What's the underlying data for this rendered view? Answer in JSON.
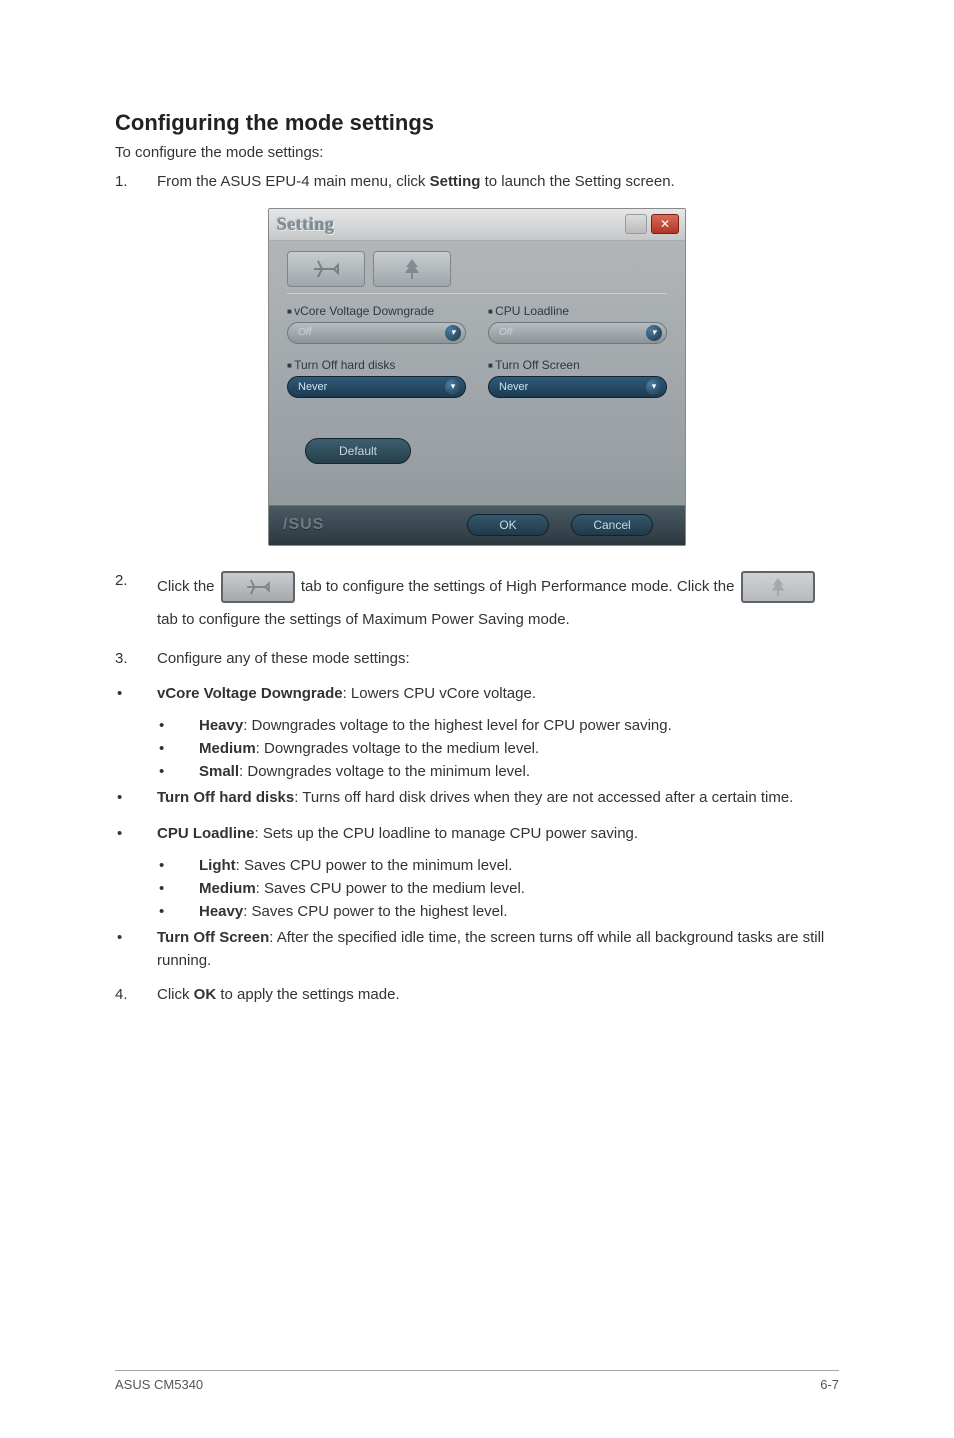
{
  "heading": "Configuring the mode settings",
  "intro": "To configure the mode settings:",
  "step1": {
    "num": "1.",
    "text_a": "From the ASUS EPU-4 main menu, click ",
    "bold": "Setting",
    "text_b": "  to launch the Setting screen."
  },
  "screenshot": {
    "title": "Setting",
    "close_glyph": "✕",
    "vcore_label": "vCore Voltage Downgrade",
    "vcore_value": "Off",
    "cpu_label": "CPU Loadline",
    "cpu_value": "Off",
    "disks_label": "Turn Off hard disks",
    "disks_value": "Never",
    "screen_label": "Turn Off Screen",
    "screen_value": "Never",
    "default_btn": "Default",
    "ok_btn": "OK",
    "cancel_btn": "Cancel",
    "asus_logo": "/SUS"
  },
  "step2": {
    "num": "2.",
    "a": "Click the ",
    "b": " tab to configure the settings of High Performance mode. Click the ",
    "c": " tab to configure the settings of Maximum Power Saving mode."
  },
  "step3": {
    "num": "3.",
    "text": "Configure any of these mode settings:"
  },
  "b_vcore": {
    "label": "vCore Voltage Downgrade",
    "tail": ": Lowers CPU vCore voltage."
  },
  "b_heavy": {
    "label": "Heavy",
    "tail": ": Downgrades voltage to the highest level for CPU power saving."
  },
  "b_medium": {
    "label": "Medium",
    "tail": ": Downgrades voltage to the medium level."
  },
  "b_small": {
    "label": "Small",
    "tail": ": Downgrades voltage to the minimum level."
  },
  "b_disks": {
    "label": "Turn Off hard disks",
    "tail": ": Turns off hard disk drives when they are not accessed after a certain time."
  },
  "b_loadline": {
    "label": "CPU Loadline",
    "tail": ": Sets up the CPU loadline to manage CPU power saving."
  },
  "b_light": {
    "label": "Light",
    "tail": ": Saves CPU power to the minimum level."
  },
  "b_med2": {
    "label": "Medium",
    "tail": ": Saves CPU power to the medium level."
  },
  "b_hvy2": {
    "label": "Heavy",
    "tail": ": Saves CPU power to the highest level."
  },
  "b_screen": {
    "label": "Turn Off Screen",
    "tail": ": After the specified idle time, the screen turns off while all background tasks are still running."
  },
  "step4": {
    "num": "4.",
    "a": "Click ",
    "bold": "OK",
    "b": " to apply the settings made."
  },
  "footer": {
    "left": "ASUS CM5340",
    "right": "6-7"
  }
}
